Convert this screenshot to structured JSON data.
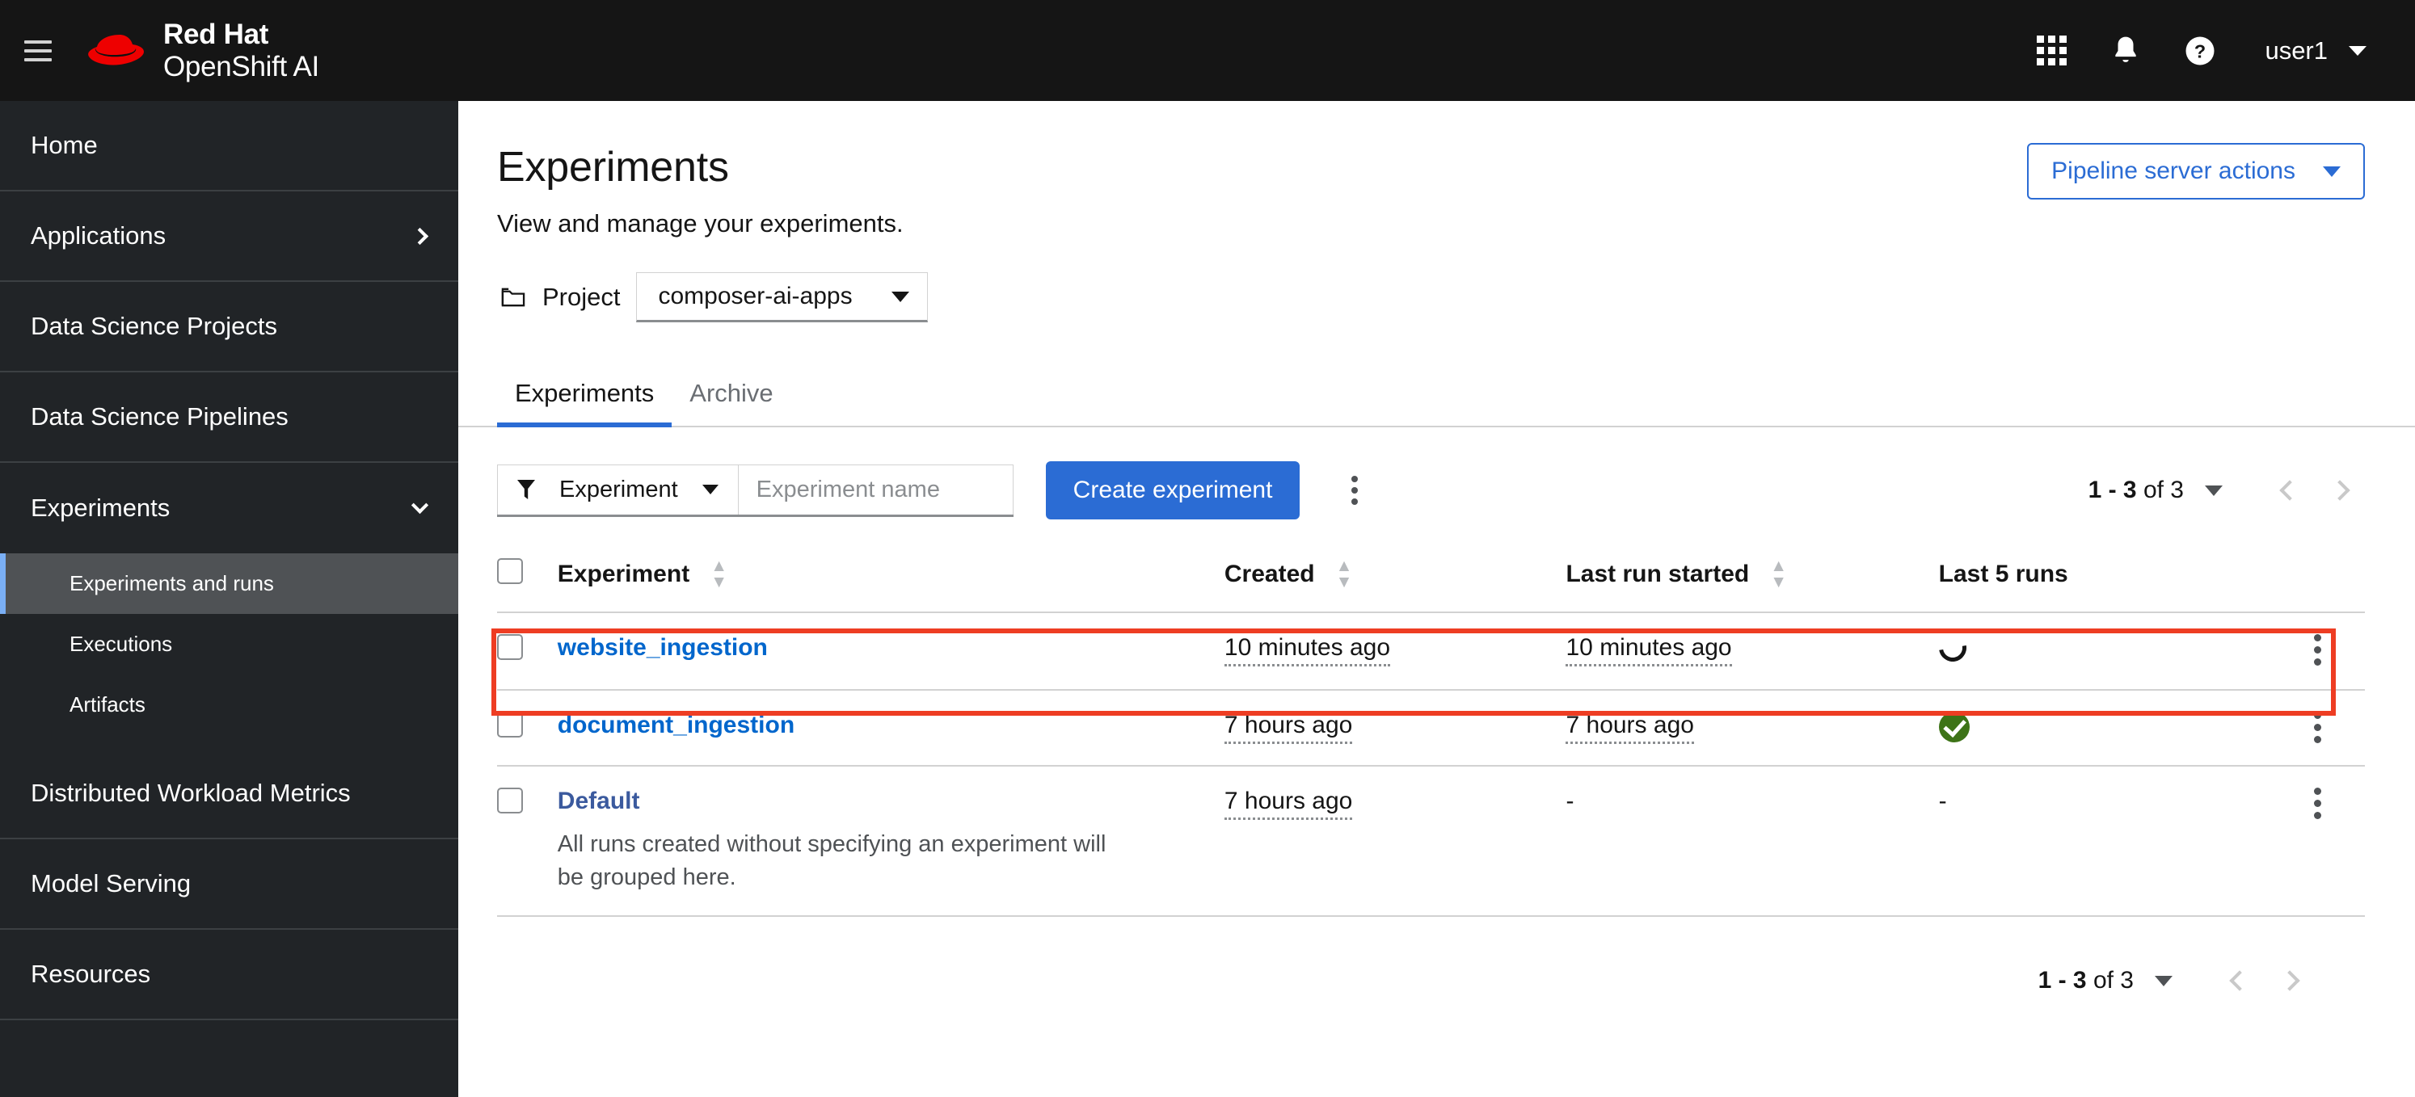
{
  "masthead": {
    "menu_icon": "hamburger-icon",
    "brand_line1": "Red Hat",
    "brand_line2": "OpenShift AI",
    "app_launcher_icon": "grid-icon",
    "notifications_icon": "bell-icon",
    "help_icon": "help-circle-icon",
    "user_name": "user1"
  },
  "sidebar": {
    "items": [
      {
        "label": "Home",
        "type": "item"
      },
      {
        "label": "Applications",
        "type": "expandable",
        "chevron": "chevron-right-icon"
      },
      {
        "label": "Data Science Projects",
        "type": "item"
      },
      {
        "label": "Data Science Pipelines",
        "type": "item"
      },
      {
        "label": "Experiments",
        "type": "expandable",
        "chevron": "chevron-down-icon"
      },
      {
        "label": "Experiments and runs",
        "type": "sub",
        "active": true
      },
      {
        "label": "Executions",
        "type": "sub",
        "active": false
      },
      {
        "label": "Artifacts",
        "type": "sub",
        "active": false
      },
      {
        "label": "Distributed Workload Metrics",
        "type": "item"
      },
      {
        "label": "Model Serving",
        "type": "item"
      },
      {
        "label": "Resources",
        "type": "item"
      }
    ]
  },
  "page": {
    "title": "Experiments",
    "description": "View and manage your experiments.",
    "pipeline_actions_label": "Pipeline server actions",
    "project_label": "Project",
    "project_icon": "folder-icon",
    "project_value": "composer-ai-apps"
  },
  "tabs": [
    {
      "label": "Experiments",
      "active": true
    },
    {
      "label": "Archive",
      "active": false
    }
  ],
  "toolbar": {
    "filter_icon": "funnel-icon",
    "filter_label": "Experiment",
    "search_placeholder": "Experiment name",
    "search_value": "",
    "create_label": "Create experiment",
    "kebab_icon": "kebab-menu-icon"
  },
  "pagination": {
    "range_prefix": "1 - 3",
    "range_suffix": "of 3",
    "text": "1 - 3 of 3",
    "prev_icon": "chevron-left-icon",
    "next_icon": "chevron-right-icon",
    "prev_enabled": false,
    "next_enabled": false
  },
  "table": {
    "columns": [
      {
        "label": "Experiment",
        "sortable": true
      },
      {
        "label": "Created",
        "sortable": true
      },
      {
        "label": "Last run started",
        "sortable": true
      },
      {
        "label": "Last 5 runs",
        "sortable": false
      }
    ],
    "rows": [
      {
        "name": "website_ingestion",
        "description": "",
        "created": "10 minutes ago",
        "last_run_started": "10 minutes ago",
        "last_5_runs": "spinner-icon",
        "link_style": "link",
        "highlighted": true
      },
      {
        "name": "document_ingestion",
        "description": "",
        "created": "7 hours ago",
        "last_run_started": "7 hours ago",
        "last_5_runs": "success-check-icon",
        "link_style": "link",
        "highlighted": false
      },
      {
        "name": "Default",
        "description": "All runs created without specifying an experiment will be grouped here.",
        "created": "7 hours ago",
        "last_run_started": "-",
        "last_5_runs": "-",
        "link_style": "visited",
        "highlighted": false
      }
    ]
  },
  "colors": {
    "masthead_bg": "#151515",
    "sidebar_bg": "#212427",
    "accent_blue": "#2b6cd4",
    "link_blue": "#0066cc",
    "visited_link": "#3b5a9e",
    "success_green": "#3d7317",
    "annotation_red": "#ee3d23",
    "active_nav_bar": "#7aaff5"
  }
}
